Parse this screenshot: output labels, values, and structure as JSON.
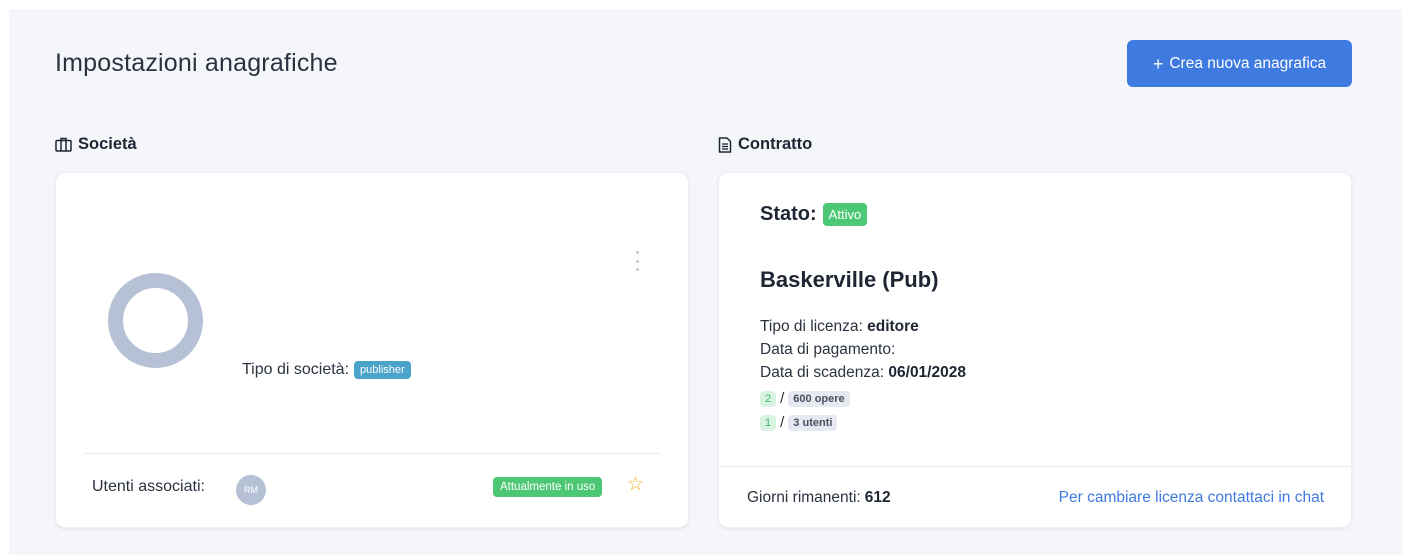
{
  "header": {
    "title": "Impostazioni anagrafiche",
    "create_button_label": "Crea nuova anagrafica"
  },
  "societa": {
    "section_title": "Società",
    "tipo_label": "Tipo di società:",
    "tipo_value": "publisher",
    "utenti_label": "Utenti associati:",
    "avatar_initials": "RM",
    "in_use_badge": "Attualmente in uso"
  },
  "contratto": {
    "section_title": "Contratto",
    "stato_label": "Stato:",
    "stato_value": "Attivo",
    "name": "Baskerville (Pub)",
    "licenza_label": "Tipo di licenza:",
    "licenza_value": "editore",
    "pagamento_label": "Data di pagamento:",
    "scadenza_label": "Data di scadenza:",
    "scadenza_value": "06/01/2028",
    "quotas": [
      {
        "used": "2",
        "total": "600 opere"
      },
      {
        "used": "1",
        "total": "3 utenti"
      }
    ],
    "giorni_label": "Giorni rimanenti:",
    "giorni_value": "612",
    "contact_link": "Per cambiare licenza contattaci in chat"
  },
  "colors": {
    "accent": "#3f7ae0",
    "success": "#4cc774",
    "info": "#4aa3c9",
    "star": "#f0b429"
  },
  "icons": [
    "plus-icon",
    "briefcase-icon",
    "document-icon",
    "kebab-menu-icon",
    "star-icon"
  ]
}
